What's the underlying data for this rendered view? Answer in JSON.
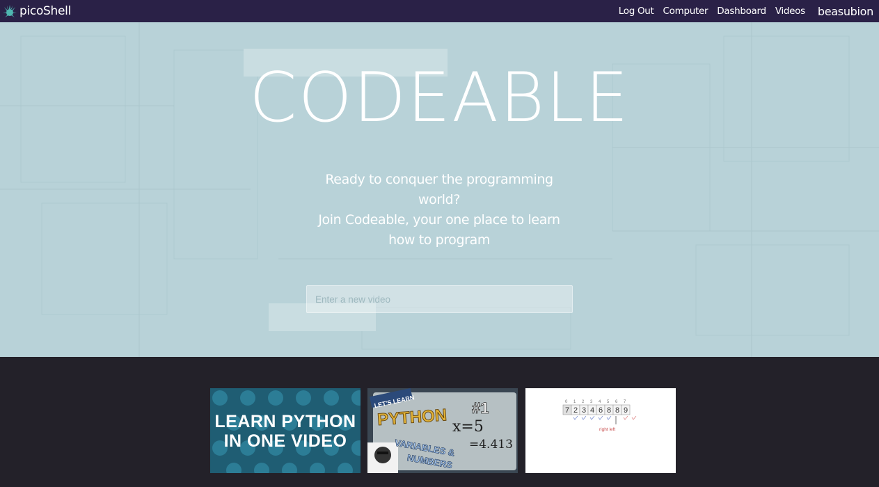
{
  "navbar": {
    "brand": "picoShell",
    "links": [
      "Log Out",
      "Computer",
      "Dashboard",
      "Videos"
    ],
    "username": "beasubion"
  },
  "hero": {
    "title": "CODEABLE",
    "subtitle_lines": [
      "Ready to conquer the programming",
      "world?",
      "Join Codeable, your one place to learn",
      "how to program"
    ],
    "input_placeholder": "Enter a new video"
  },
  "videos": [
    {
      "line1": "LEARN PYTHON",
      "line2": "IN ONE VIDEO"
    },
    {
      "badge": "LET'S LEARN",
      "title": "PYTHON",
      "number": "#1",
      "eq1": "x=5",
      "eq2": "=4.413",
      "words1": "VARIABLES &",
      "words2": "NUMBERS"
    },
    {
      "digits": [
        "7",
        "2",
        "3",
        "4",
        "6",
        "8",
        "8",
        "9"
      ],
      "indices": [
        "0",
        "1",
        "2",
        "3",
        "4",
        "5",
        "6",
        "7"
      ],
      "caption": "right left"
    }
  ],
  "colors": {
    "navbar_bg": "#2a2147",
    "hero_bg": "#b9d3d9",
    "footer_bg": "#232129"
  }
}
